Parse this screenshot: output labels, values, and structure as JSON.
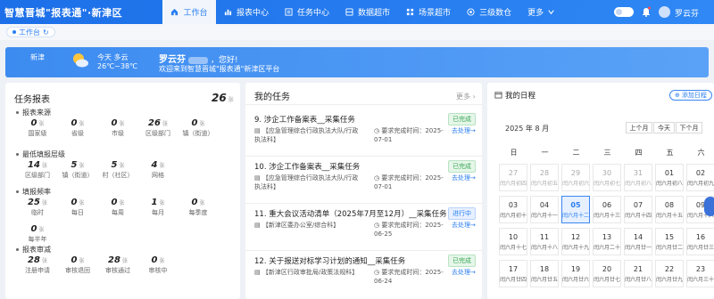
{
  "header": {
    "brand": "智慧晋城\"报表通\"·新津区",
    "nav": [
      {
        "label": "工作台",
        "icon": "home-icon",
        "active": true
      },
      {
        "label": "报表中心",
        "icon": "chart-icon"
      },
      {
        "label": "任务中心",
        "icon": "list-icon"
      },
      {
        "label": "数据超市",
        "icon": "database-icon"
      },
      {
        "label": "场景超市",
        "icon": "grid-icon"
      },
      {
        "label": "三级数仓",
        "icon": "layers-icon"
      },
      {
        "label": "更多",
        "icon": "more-icon"
      }
    ],
    "user_name": "罗云芬"
  },
  "tabbar": {
    "tab_label": "工作台"
  },
  "banner": {
    "city": "新津",
    "weather_day": "今天",
    "weather_desc": "多云",
    "temperature": "26℃~38℃",
    "greeting_name": "罗云芬",
    "greeting_suffix": "，您好!",
    "welcome": "欢迎来到智慧晋城\"报表通\"新津区平台"
  },
  "task_report": {
    "title": "任务报表",
    "total": "26",
    "unit": "张",
    "sections": [
      {
        "title": "报表来源",
        "items": [
          {
            "value": "0",
            "label": "国家级"
          },
          {
            "value": "0",
            "label": "省级"
          },
          {
            "value": "0",
            "label": "市级"
          },
          {
            "value": "26",
            "label": "区级部门"
          },
          {
            "value": "0",
            "label": "镇（街道）"
          }
        ]
      },
      {
        "title": "最低填报层级",
        "items": [
          {
            "value": "14",
            "label": "区级部门"
          },
          {
            "value": "5",
            "label": "镇（街道）"
          },
          {
            "value": "5",
            "label": "村（社区）"
          },
          {
            "value": "4",
            "label": "网格"
          }
        ]
      },
      {
        "title": "填报频率",
        "items": [
          {
            "value": "25",
            "label": "临时"
          },
          {
            "value": "0",
            "label": "每日"
          },
          {
            "value": "0",
            "label": "每周"
          },
          {
            "value": "1",
            "label": "每月"
          },
          {
            "value": "0",
            "label": "每季度"
          },
          {
            "value": "0",
            "label": "每半年"
          }
        ]
      },
      {
        "title": "报表审减",
        "items": [
          {
            "value": "28",
            "label": "注册申请"
          },
          {
            "value": "0",
            "label": "审核退回"
          },
          {
            "value": "28",
            "label": "审核通过"
          },
          {
            "value": "0",
            "label": "审核中"
          }
        ]
      }
    ]
  },
  "my_tasks": {
    "title": "我的任务",
    "more": "更多",
    "tasks": [
      {
        "title": "9.  涉企工作备案表__采集任务",
        "status": "已完成",
        "status_type": "done",
        "org": "【应急管理综合行政执法大队/行政执法科】",
        "deadline": "要求完成时间：2025-07-01",
        "action": "去处理→"
      },
      {
        "title": "10.  涉企工作备案表__采集任务",
        "status": "已完成",
        "status_type": "done",
        "org": "【应急管理综合行政执法大队/行政执法科】",
        "deadline": "要求完成时间：2025-07-01",
        "action": "去处理→"
      },
      {
        "title": "11.  重大会议活动清单（2025年7月至12月）__采集任务",
        "status": "进行中",
        "status_type": "prog",
        "org": "【新津区委办公室/综合科】",
        "deadline": "要求完成时间：2025-06-25",
        "action": "去处理→"
      },
      {
        "title": "12.  关于报送对标学习计划的通知__采集任务",
        "status": "已完成",
        "status_type": "done",
        "org": "【新津区行政审批局/政策法规科】",
        "deadline": "要求完成时间：2025-06-24",
        "action": "去处理→"
      }
    ]
  },
  "calendar": {
    "title": "我的日程",
    "add_label": "添加日程",
    "month_label": "2025 年 8 月",
    "buttons": [
      "上个月",
      "今天",
      "下个月"
    ],
    "weekdays": [
      "日",
      "一",
      "二",
      "三",
      "四",
      "五",
      "六"
    ],
    "rows": [
      [
        {
          "d": "27",
          "s": "闰六月初四",
          "dim": true
        },
        {
          "d": "28",
          "s": "闰六月初五",
          "dim": true
        },
        {
          "d": "29",
          "s": "闰六月初六",
          "dim": true
        },
        {
          "d": "30",
          "s": "闰六月初七",
          "dim": true
        },
        {
          "d": "31",
          "s": "闰六月初八",
          "dim": true
        },
        {
          "d": "01",
          "s": "闰六月初八"
        },
        {
          "d": "02",
          "s": "闰六月初九"
        }
      ],
      [
        {
          "d": "03",
          "s": "闰六月初十"
        },
        {
          "d": "04",
          "s": "闰六月十一"
        },
        {
          "d": "05",
          "s": "闰六月十二",
          "today": true
        },
        {
          "d": "06",
          "s": "闰六月十三"
        },
        {
          "d": "07",
          "s": "闰六月十四"
        },
        {
          "d": "08",
          "s": "闰六月十五"
        },
        {
          "d": "09",
          "s": "闰六月十六"
        }
      ],
      [
        {
          "d": "10",
          "s": "闰六月十七"
        },
        {
          "d": "11",
          "s": "闰六月十八"
        },
        {
          "d": "12",
          "s": "闰六月十九"
        },
        {
          "d": "13",
          "s": "闰六月二十"
        },
        {
          "d": "14",
          "s": "闰六月廿一"
        },
        {
          "d": "15",
          "s": "闰六月廿二"
        },
        {
          "d": "16",
          "s": "闰六月廿三"
        }
      ],
      [
        {
          "d": "17",
          "s": "闰六月廿四"
        },
        {
          "d": "18",
          "s": "闰六月廿五"
        },
        {
          "d": "19",
          "s": "闰六月廿六"
        },
        {
          "d": "20",
          "s": "闰六月廿七"
        },
        {
          "d": "21",
          "s": "闰六月廿八"
        },
        {
          "d": "22",
          "s": "闰六月廿九"
        },
        {
          "d": "23",
          "s": "闰六月三十"
        }
      ]
    ]
  }
}
